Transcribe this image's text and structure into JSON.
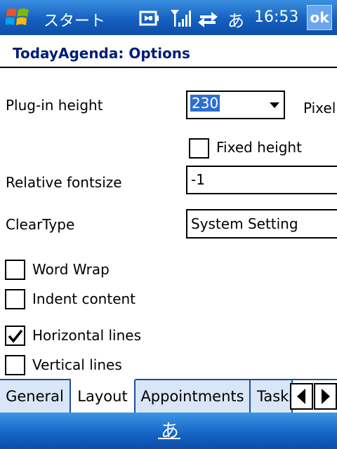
{
  "status_bar": {
    "start_label": "スタート",
    "ime_indicator": "あ",
    "time": "16:53",
    "ok_label": "ok",
    "icons": [
      "windows-logo-icon",
      "battery-icon",
      "signal-icon",
      "connectivity-icon"
    ]
  },
  "dialog": {
    "title": "TodayAgenda: Options"
  },
  "form": {
    "plugin_height": {
      "label": "Plug-in height",
      "value": "230",
      "unit": "Pixel"
    },
    "fixed_height": {
      "label": "Fixed height",
      "checked": false
    },
    "relative_fontsize": {
      "label": "Relative fontsize",
      "value": "-1"
    },
    "cleartype": {
      "label": "ClearType",
      "value": "System Setting"
    },
    "word_wrap": {
      "label": "Word Wrap",
      "checked": false
    },
    "indent_content": {
      "label": "Indent content",
      "checked": false
    },
    "horizontal_lines": {
      "label": "Horizontal lines",
      "checked": true
    },
    "vertical_lines": {
      "label": "Vertical lines",
      "checked": false
    }
  },
  "tabs": [
    {
      "label": "General",
      "active": false
    },
    {
      "label": "Layout",
      "active": true
    },
    {
      "label": "Appointments",
      "active": false
    },
    {
      "label": "Tasks",
      "active": false
    }
  ],
  "bottom_bar": {
    "ime_label": "あ"
  },
  "colors": {
    "bar_blue": "#1560c0",
    "title_navy": "#001c7a",
    "selection_blue": "#2d6fcf"
  }
}
